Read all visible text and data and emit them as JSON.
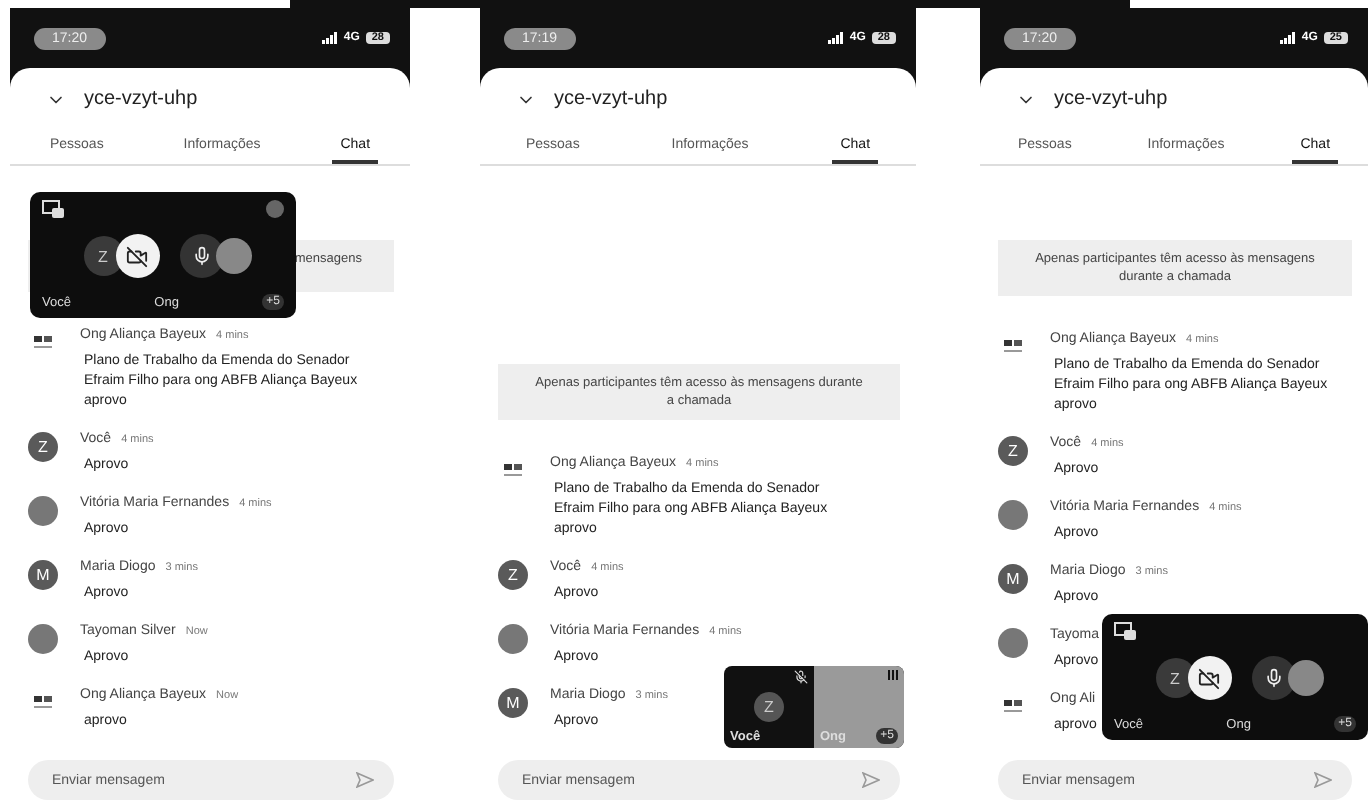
{
  "phones": [
    {
      "status": {
        "time": "17:20",
        "network": "4G",
        "battery": "28"
      },
      "title": "yce-vzyt-uhp",
      "tabs": [
        {
          "label": "Pessoas",
          "selected": false
        },
        {
          "label": "Informações",
          "selected": false
        },
        {
          "label": "Chat",
          "selected": true
        }
      ],
      "notice": "mensagens",
      "messages": [
        {
          "kind": "logo",
          "sender": "Ong Aliança Bayeux",
          "time": "4 mins",
          "text": "Plano de Trabalho da Emenda do Senador\nEfraim Filho para ong ABFB Aliança Bayeux\naprovo"
        },
        {
          "kind": "initial",
          "initial": "Z",
          "sender": "Você",
          "time": "4 mins",
          "text": "Aprovo"
        },
        {
          "kind": "photo",
          "sender": "Vitória Maria Fernandes",
          "time": "4 mins",
          "text": "Aprovo"
        },
        {
          "kind": "initial",
          "initial": "M",
          "sender": "Maria Diogo",
          "time": "3 mins",
          "text": "Aprovo"
        },
        {
          "kind": "photo",
          "sender": "Tayoman Silver",
          "time": "Now",
          "text": "Aprovo"
        },
        {
          "kind": "logo",
          "sender": "Ong Aliança Bayeux",
          "time": "Now",
          "text": "aprovo"
        }
      ],
      "call": {
        "kind": "controls",
        "expand_icon": true,
        "self_initial": "Z",
        "self_label": "Você",
        "other_label": "Ong",
        "more": "+5"
      },
      "input": {
        "placeholder": "Enviar mensagem"
      }
    },
    {
      "status": {
        "time": "17:19",
        "network": "4G",
        "battery": "28"
      },
      "title": "yce-vzyt-uhp",
      "tabs": [
        {
          "label": "Pessoas",
          "selected": false
        },
        {
          "label": "Informações",
          "selected": false
        },
        {
          "label": "Chat",
          "selected": true
        }
      ],
      "notice": "Apenas participantes têm acesso às mensagens durante a chamada",
      "messages": [
        {
          "kind": "logo",
          "sender": "Ong Aliança Bayeux",
          "time": "4 mins",
          "text": "Plano de Trabalho da Emenda do Senador\nEfraim Filho para ong ABFB Aliança Bayeux\naprovo"
        },
        {
          "kind": "initial",
          "initial": "Z",
          "sender": "Você",
          "time": "4 mins",
          "text": "Aprovo"
        },
        {
          "kind": "photo",
          "sender": "Vitória Maria Fernandes",
          "time": "4 mins",
          "text": "Aprovo"
        },
        {
          "kind": "initial",
          "initial": "M",
          "sender": "Maria Diogo",
          "time": "3 mins",
          "text": "Aprovo"
        }
      ],
      "call": {
        "kind": "mini",
        "self_initial": "Z",
        "self_label": "Você",
        "other_label": "Ong",
        "more": "+5"
      },
      "input": {
        "placeholder": "Enviar mensagem"
      }
    },
    {
      "status": {
        "time": "17:20",
        "network": "4G",
        "battery": "25"
      },
      "title": "yce-vzyt-uhp",
      "tabs": [
        {
          "label": "Pessoas",
          "selected": false
        },
        {
          "label": "Informações",
          "selected": false
        },
        {
          "label": "Chat",
          "selected": true
        }
      ],
      "notice": "Apenas participantes têm acesso às mensagens durante a chamada",
      "messages": [
        {
          "kind": "logo",
          "sender": "Ong Aliança Bayeux",
          "time": "4 mins",
          "text": "Plano de Trabalho da Emenda do Senador\nEfraim Filho para ong ABFB Aliança Bayeux\naprovo"
        },
        {
          "kind": "initial",
          "initial": "Z",
          "sender": "Você",
          "time": "4 mins",
          "text": "Aprovo"
        },
        {
          "kind": "photo",
          "sender": "Vitória Maria Fernandes",
          "time": "4 mins",
          "text": "Aprovo"
        },
        {
          "kind": "initial",
          "initial": "M",
          "sender": "Maria Diogo",
          "time": "3 mins",
          "text": "Aprovo"
        },
        {
          "kind": "photo",
          "sender": "Tayoma",
          "text": "Aprovo"
        },
        {
          "kind": "logo",
          "sender": "Ong Ali",
          "text": "aprovo"
        }
      ],
      "call": {
        "kind": "controls",
        "expand_icon": false,
        "self_initial": "Z",
        "self_label": "Você",
        "other_label": "Ong",
        "more": "+5"
      },
      "input": {
        "placeholder": "Enviar mensagem"
      }
    }
  ]
}
